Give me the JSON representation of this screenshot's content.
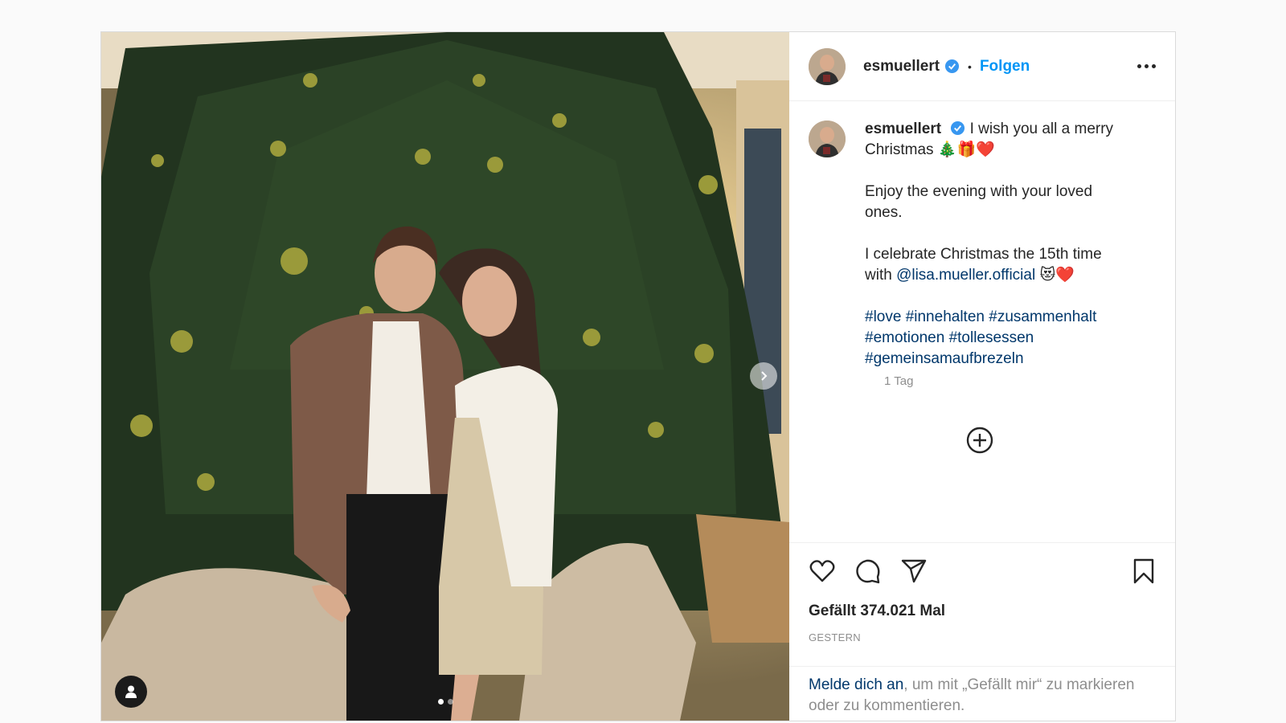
{
  "post": {
    "username": "esmuellert",
    "follow_label": "Folgen",
    "separator": "•",
    "caption": {
      "line1": "I wish you all a merry Christmas",
      "line1_emoji": "🎄🎁❤️",
      "para2": "Enjoy the evening with your loved ones.",
      "para3_prefix": "I celebrate Christmas the 15th time with ",
      "mention": "@lisa.mueller.official",
      "para3_emoji": "😻❤️",
      "hashtags": [
        "#love",
        "#innehalten",
        "#zusammenhalt",
        "#emotionen",
        "#tollesessen",
        "#gemeinsamaufbrezeln"
      ]
    },
    "caption_time": "1 Tag",
    "likes_text": "Gefällt 374.021 Mal",
    "date_label": "GESTERN",
    "login": {
      "link": "Melde dich an",
      "rest": ", um mit „Gefällt mir“ zu markieren oder zu kommentieren."
    },
    "carousel": {
      "slides": 2,
      "active": 1
    }
  },
  "icons": {
    "verified": "verified-badge-icon",
    "more": "more-options-icon",
    "like": "heart-icon",
    "comment": "comment-icon",
    "share": "paper-plane-icon",
    "save": "bookmark-icon",
    "add": "add-circle-icon",
    "next": "chevron-right-icon",
    "tag": "user-tag-icon"
  },
  "colors": {
    "accent": "#0095f6",
    "link": "#00376b",
    "muted": "#8e8e8e"
  }
}
